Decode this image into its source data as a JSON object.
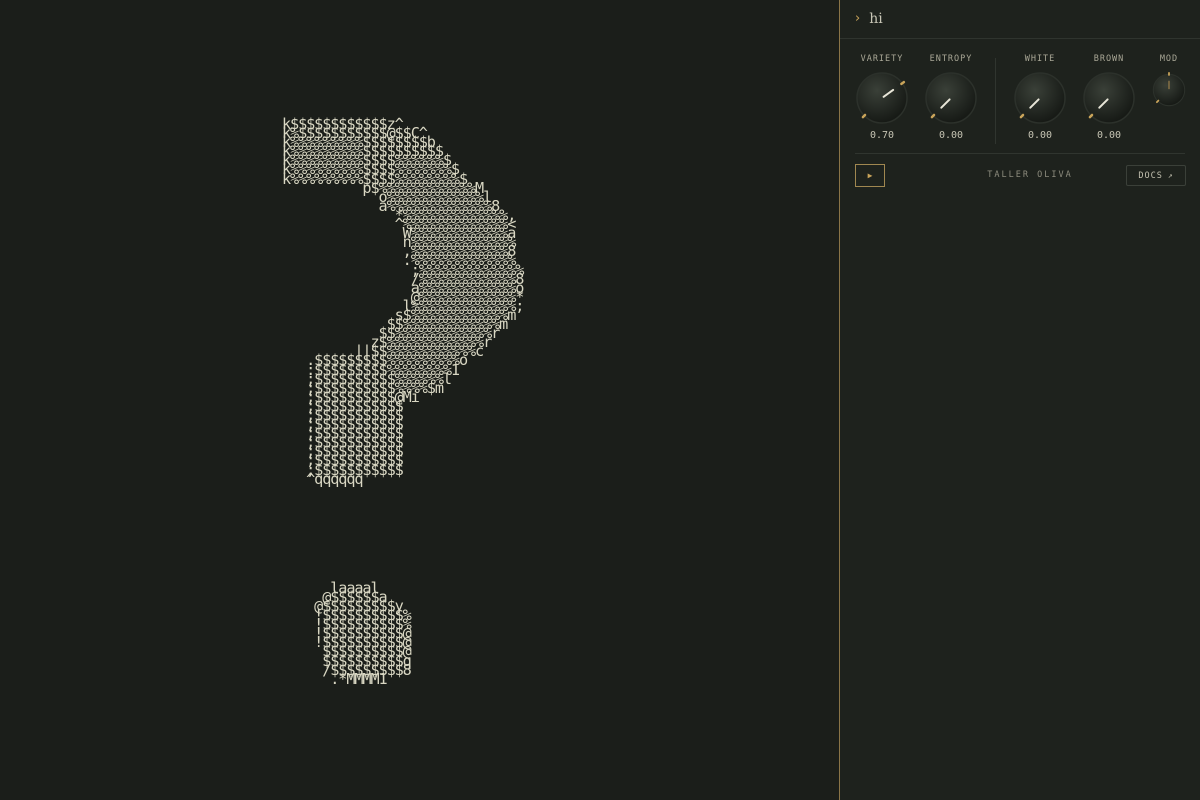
{
  "ascii_art": {
    "lines": [
      "k$$$$$$$$$$$$z^",
      "k%$$$$$$$$$$$@$$C^",
      "k%%%%%%%%%$$$$$$$$b",
      "k%%%%%%%%%$$$$$$$$$$",
      "k%%%%%%%%%$$$$%%%%%%$",
      "k%%%%%%%%%$$$$%%%%%%%$",
      "k%%%%%%%%%$$$$%%%%%%%%$",
      "          p$%%%%%%%%%%%%M",
      "            o%%%%%%%%%%%%l",
      "            a%%%%%%%%%%%%%8",
      "              *%%%%%%%%%%%%%,",
      "              ^%%%%%%%%%%%%%<",
      "               W%%%%%%%%%%%%a",
      "               n%%%%%%%%%%%%%",
      "               ,%%%%%%%%%%%%8",
      "               .%%%%%%%%%%%%%",
      "                ;%%%%%%%%%%%%%",
      "                /%%%%%%%%%%%%8",
      "                a%%%%%%%%%%%%o",
      "                @%%%%%%%%%%%%*",
      "               l%%%%%%%%%%%%%;",
      "              s$%%%%%%%%%%%%m",
      "             $$%%%%%%%%%%%%m",
      "            $$%%%%%%%%%%%%r",
      "           z$%%%%%%%%%%%%r",
      "         ||$$%%%%%%%%%%%c",
      "   .$$$$$$$$$%%%%%%%%%o",
      "   :$$$$$$$$$%%%%%%%%1",
      "   ;$$$$$$$$$$%%%%%%l",
      "   ;$$$$$$$$$$%%%%$m",
      "   ;$$$$$$$$$$@Mi",
      "   ;$$$$$$$$$$$",
      "   ;$$$$$$$$$$$",
      "   ;$$$$$$$$$$$",
      "   ;$$$$$$$$$$$",
      "   ;$$$$$$$$$$$",
      "   ;$$$$$$$$$$$",
      "   ;$$$$$$$$$$$",
      "   ;$$$$$$$$$$$",
      "   ^qqqqqq",
      "",
      "",
      "",
      "",
      "",
      "",
      "",
      "",
      "",
      "",
      "",
      "      laaaal",
      "     @$$$$$$a",
      "    @$$$$$$$$$y",
      "    !$$$$$$$$$$%",
      "    !$$$$$$$$$$%",
      "    !$$$$$$$$$$@",
      "    !$$$$$$$$$$@",
      "     $$$$$$$$$$@",
      "     $$$$$$$$$$q",
      "     /$$$$$$$$$8",
      "      .*MMMM1"
    ]
  },
  "panel": {
    "prompt_text": "hi",
    "knobs": [
      {
        "label": "VARIETY",
        "value": "0.70",
        "level": 0.7
      },
      {
        "label": "ENTROPY",
        "value": "0.00",
        "level": 0.0
      },
      {
        "label": "WHITE",
        "value": "0.00",
        "level": 0.0
      },
      {
        "label": "BROWN",
        "value": "0.00",
        "level": 0.0
      },
      {
        "label": "MOD",
        "value": "",
        "level": 0.5
      }
    ],
    "play_label": "▶",
    "brand": "TALLER OLIVA",
    "docs_label": "DOCS",
    "docs_arrow": "↗"
  },
  "colors": {
    "background": "#1b1e1a",
    "ascii": "#d9d7c3",
    "accent": "#c9a45a",
    "panel": "#1e221d"
  }
}
